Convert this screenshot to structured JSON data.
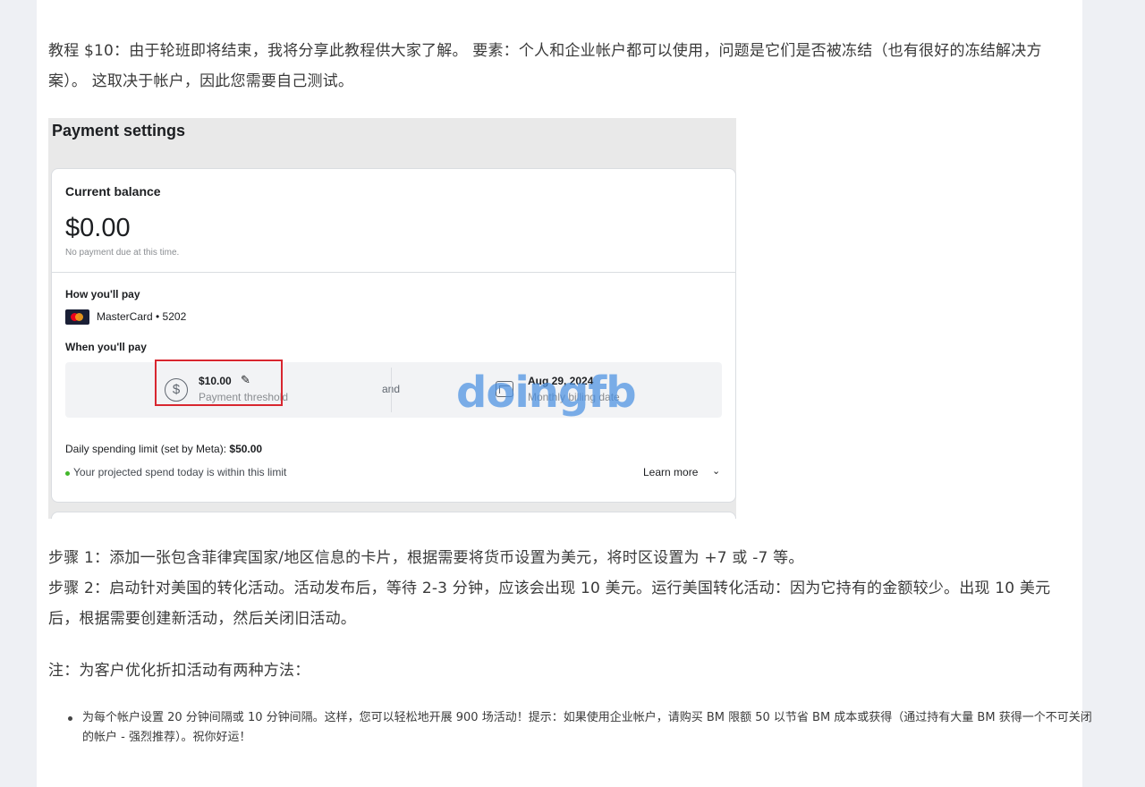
{
  "article": {
    "intro": "教程 $10：由于轮班即将结束，我将分享此教程供大家了解。 要素：个人和企业帐户都可以使用，问题是它们是否被冻结（也有很好的冻结解决方案）。 这取决于帐户，因此您需要自己测试。",
    "step1": "步骤 1：添加一张包含菲律宾国家/地区信息的卡片，根据需要将货币设置为美元，将时区设置为 +7 或 -7 等。",
    "step2": "步骤 2：启动针对美国的转化活动。活动发布后，等待 2-3 分钟，应该会出现 10 美元。运行美国转化活动：因为它持有的金额较少。出现 10 美元后，根据需要创建新活动，然后关闭旧活动。",
    "note": "注：为客户优化折扣活动有两种方法：",
    "tips": [
      "为每个帐户设置 20 分钟间隔或 10 分钟间隔。这样，您可以轻松地开展 900 场活动！提示：如果使用企业帐户，请购买 BM 限额 50 以节省 BM 成本或获得（通过持有大量 BM 获得一个不可关闭的帐户 - 强烈推荐）。祝你好运！"
    ]
  },
  "screenshot": {
    "title": "Payment settings",
    "current_balance_label": "Current balance",
    "balance_value": "$0.00",
    "balance_note": "No payment due at this time.",
    "how_pay_label": "How you'll pay",
    "card_name": "MasterCard • 5202",
    "when_pay_label": "When you'll pay",
    "threshold_amount": "$10.00",
    "threshold_label": "Payment threshold",
    "and_text": "and",
    "billing_date": "Aug 29, 2024",
    "billing_label": "Monthly billing date",
    "daily_limit_prefix": "Daily spending limit (set by Meta): ",
    "daily_limit_value": "$50.00",
    "projected_text": "Your projected spend today is within this limit",
    "learn_more": "Learn more",
    "watermark": "doingfb",
    "highlight_color": "#d8262f",
    "status_color": "#42b72a"
  }
}
